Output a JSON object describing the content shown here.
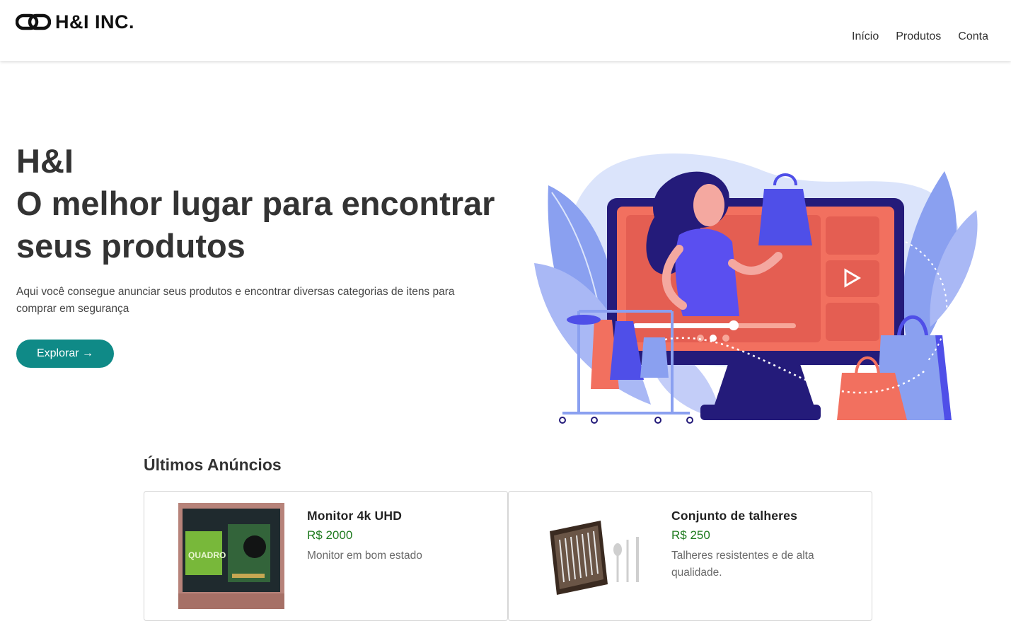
{
  "brand": {
    "name": "H&I INC."
  },
  "nav": {
    "items": [
      "Início",
      "Produtos",
      "Conta"
    ]
  },
  "hero": {
    "title_line1": "H&I",
    "title_line2": "O melhor lugar para encontrar",
    "title_line3": "seus produtos",
    "description": "Aqui você consegue anunciar seus produtos e encontrar diversas categorias de itens para comprar em segurança",
    "cta_label": "Explorar →",
    "cta_color": "#0f8a87"
  },
  "listings": {
    "title": "Últimos Anúncios",
    "items": [
      {
        "title": "Monitor 4k UHD",
        "price": "R$ 2000",
        "description": "Monitor em bom estado",
        "image_icon": "graphics-card-photo",
        "image_text": "QUADRO"
      },
      {
        "title": "Conjunto de talheres",
        "price": "R$ 250",
        "description": "Talheres resistentes e de alta qualidade.",
        "image_icon": "cutlery-set-photo"
      }
    ]
  },
  "colors": {
    "price": "#1e7a1e",
    "screen": "#f2705f",
    "monitor_frame": "#241b7a",
    "leaves": "#8aa0f0",
    "bags": "#4f4fe8"
  }
}
